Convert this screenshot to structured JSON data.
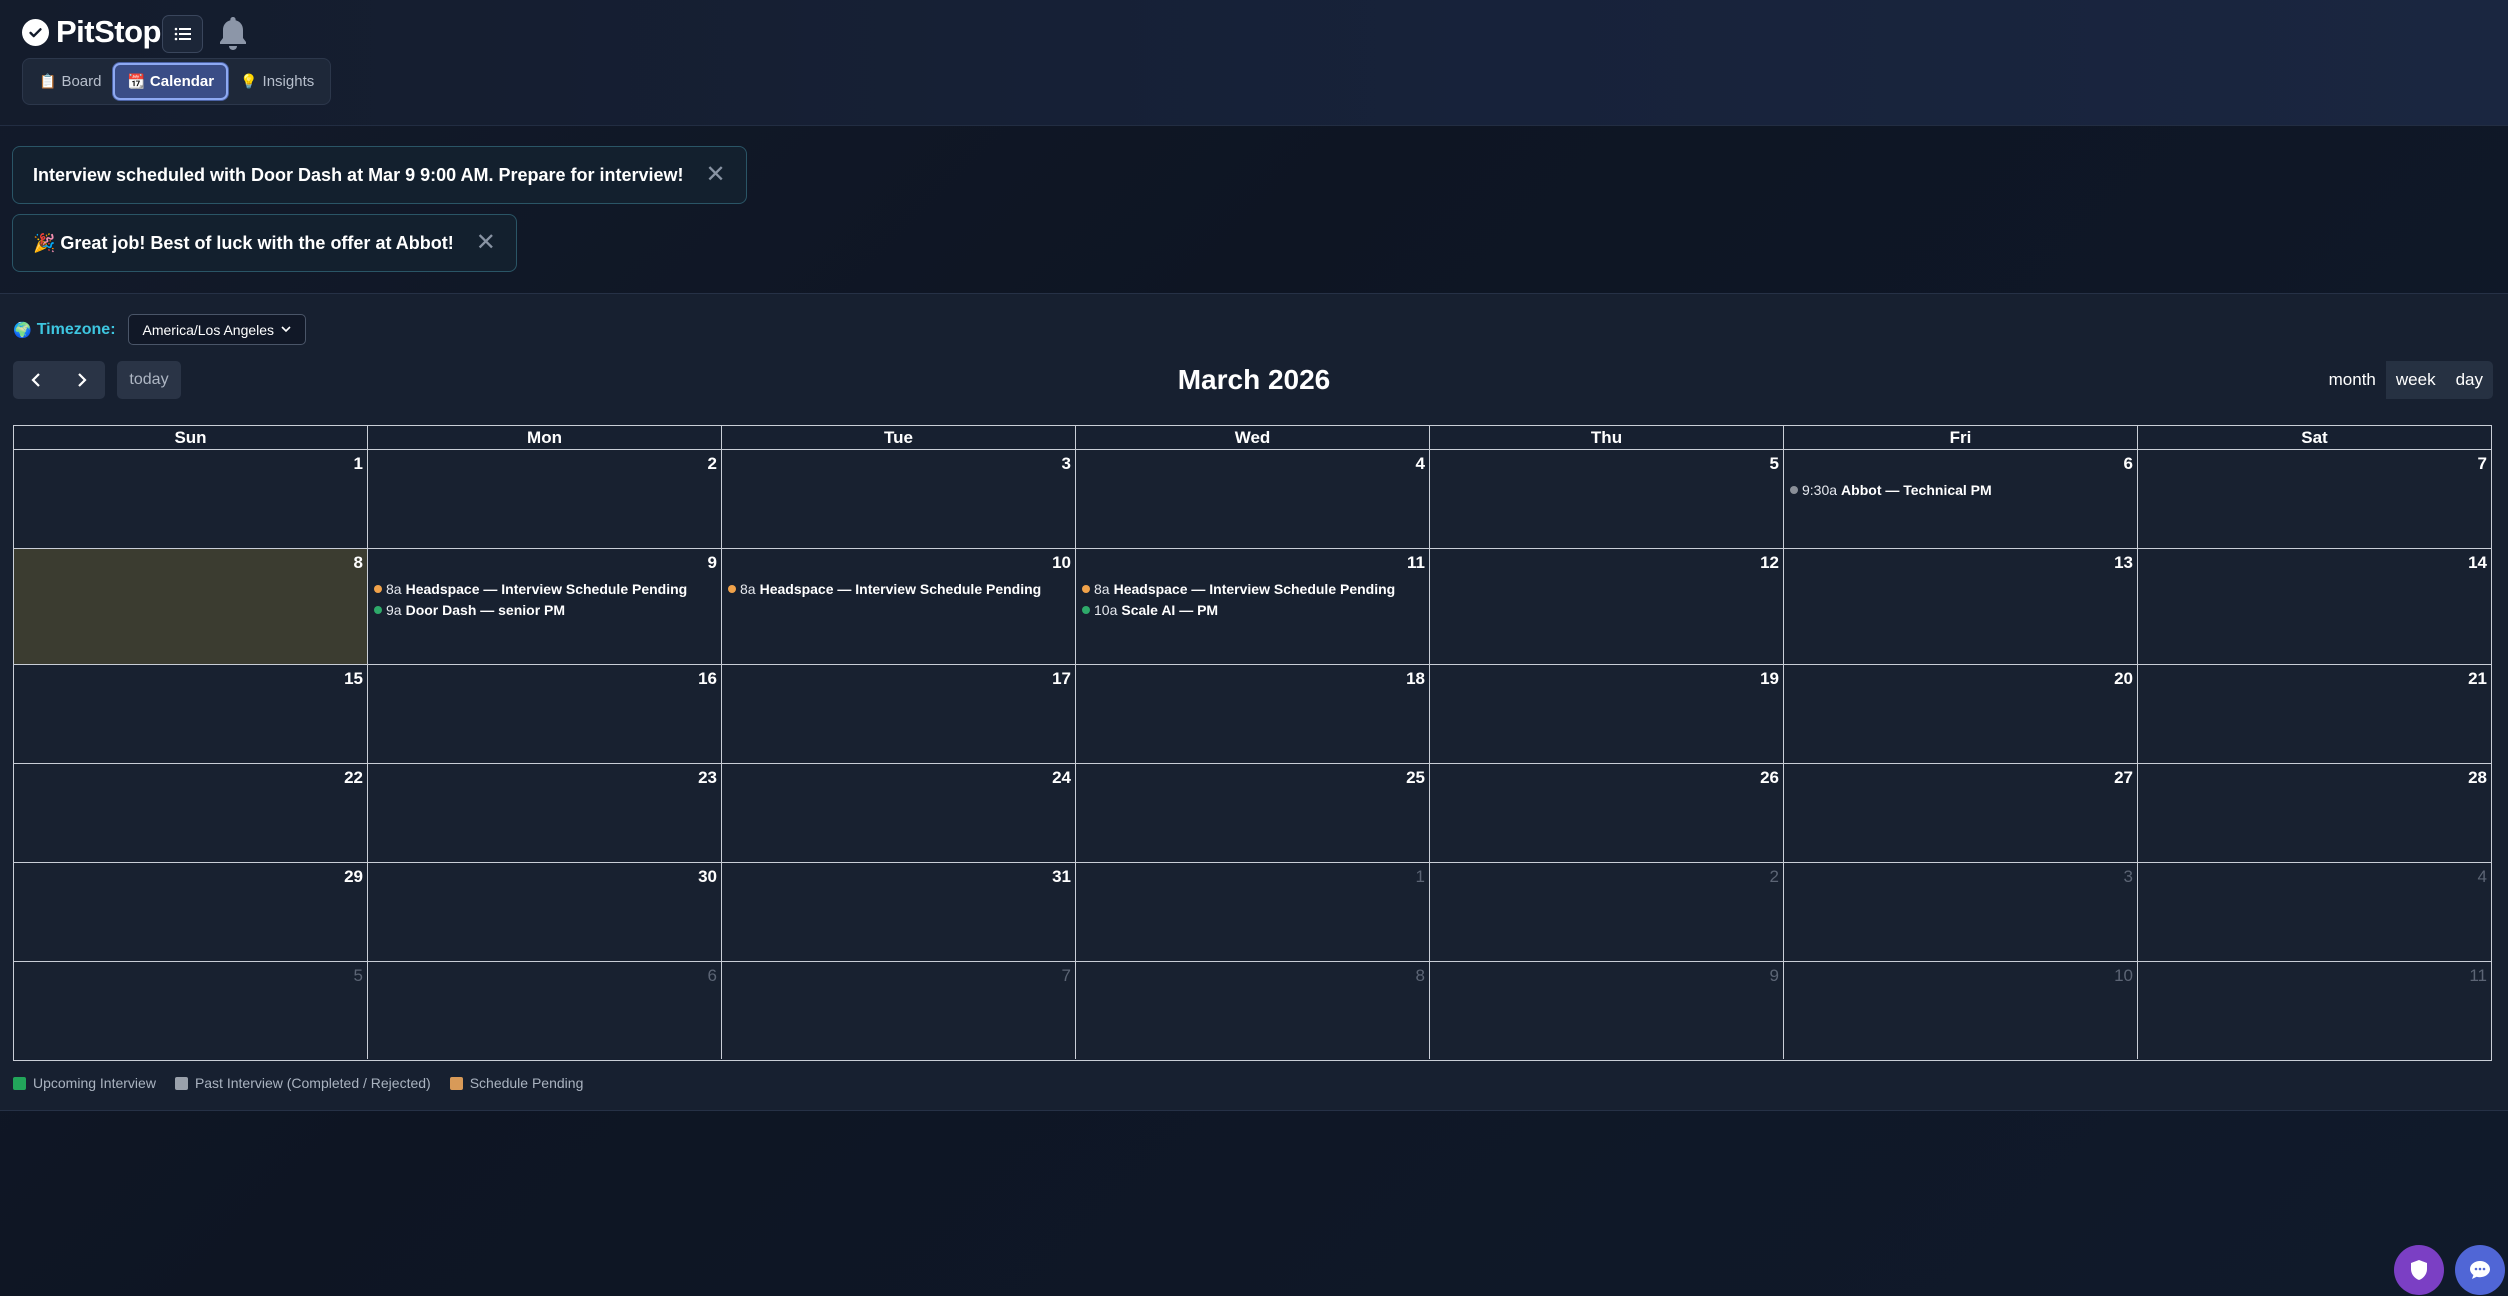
{
  "app": {
    "name": "PitStop"
  },
  "nav": {
    "tabs": [
      {
        "icon": "📋",
        "label": "Board"
      },
      {
        "icon": "📆",
        "label": "Calendar"
      },
      {
        "icon": "💡",
        "label": "Insights"
      }
    ],
    "active": "Calendar"
  },
  "notifications": [
    {
      "text": "Interview scheduled with Door Dash at Mar 9 9:00 AM. Prepare for interview!",
      "close": "✕"
    },
    {
      "text": "🎉 Great job! Best of luck with the offer at Abbot!",
      "close": "✕"
    }
  ],
  "timezone": {
    "icon": "🌍",
    "label": "Timezone:",
    "value": "America/Los Angeles"
  },
  "toolbar": {
    "prev": "‹",
    "next": "›",
    "today": "today",
    "title": "March 2026",
    "views": [
      "month",
      "week",
      "day"
    ]
  },
  "calendar": {
    "days_of_week": [
      "Sun",
      "Mon",
      "Tue",
      "Wed",
      "Thu",
      "Fri",
      "Sat"
    ],
    "weeks": [
      [
        "1",
        "2",
        "3",
        "4",
        "5",
        "6",
        "7"
      ],
      [
        "8",
        "9",
        "10",
        "11",
        "12",
        "13",
        "14"
      ],
      [
        "15",
        "16",
        "17",
        "18",
        "19",
        "20",
        "21"
      ],
      [
        "22",
        "23",
        "24",
        "25",
        "26",
        "27",
        "28"
      ],
      [
        "29",
        "30",
        "31",
        "1",
        "2",
        "3",
        "4"
      ],
      [
        "5",
        "6",
        "7",
        "8",
        "9",
        "10",
        "11"
      ]
    ],
    "events": {
      "fri6": [
        {
          "time": "9:30a",
          "title": "Abbot — Technical PM",
          "color": "#8a8f98"
        }
      ],
      "mon9": [
        {
          "time": "8a",
          "title": "Headspace — Interview Schedule Pending",
          "color": "#f0a24a"
        },
        {
          "time": "9a",
          "title": "Door Dash — senior PM",
          "color": "#2eaa6a"
        }
      ],
      "tue10": [
        {
          "time": "8a",
          "title": "Headspace — Interview Schedule Pending",
          "color": "#f0a24a"
        }
      ],
      "wed11": [
        {
          "time": "8a",
          "title": "Headspace — Interview Schedule Pending",
          "color": "#f0a24a"
        },
        {
          "time": "10a",
          "title": "Scale AI — PM",
          "color": "#2eaa6a"
        }
      ]
    }
  },
  "legend": [
    {
      "label": "Upcoming Interview",
      "color": "#22a55a"
    },
    {
      "label": "Past Interview (Completed / Rejected)",
      "color": "#9aa1ab"
    },
    {
      "label": "Schedule Pending",
      "color": "#d89a58"
    }
  ],
  "colors": {
    "accent": "#3ec6e0",
    "active_tab": "#3a4d86",
    "today_bg": "#3b3c30"
  }
}
